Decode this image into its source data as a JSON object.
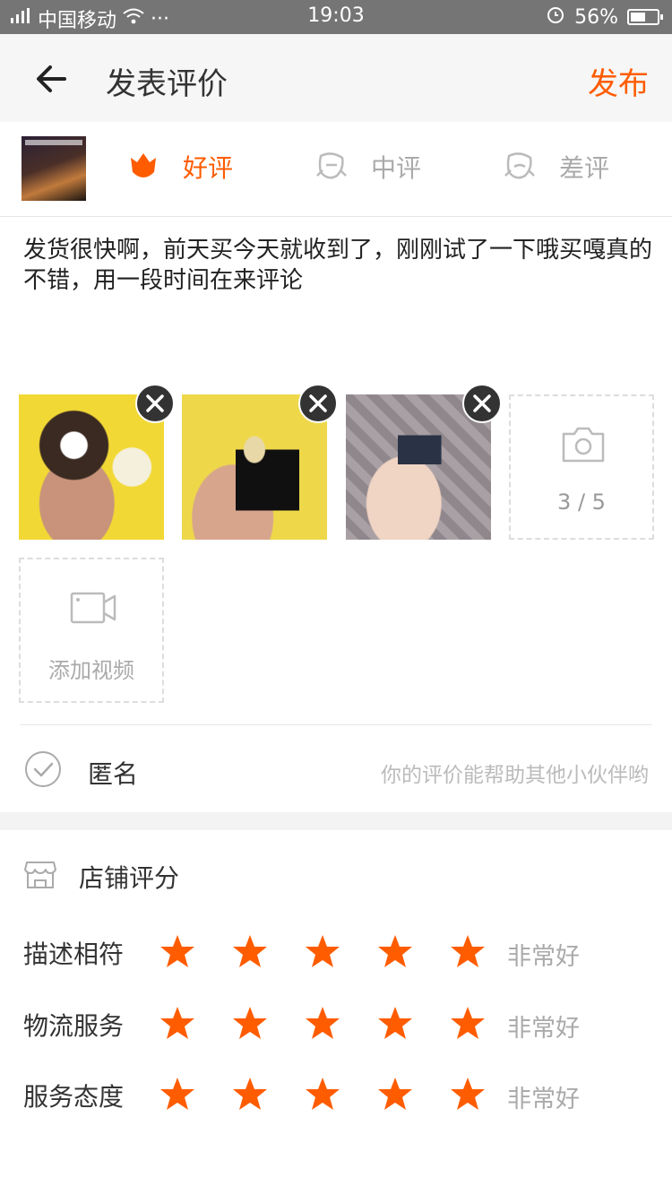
{
  "status_bar": {
    "carrier": "中国移动",
    "dots": "···",
    "time": "19:03",
    "battery_pct": "56%",
    "battery_level": 0.56
  },
  "header": {
    "title": "发表评价",
    "publish_label": "发布"
  },
  "rating_options": [
    {
      "label": "好评",
      "selected": true
    },
    {
      "label": "中评",
      "selected": false
    },
    {
      "label": "差评",
      "selected": false
    }
  ],
  "review": {
    "text": "发货很快啊，前天买今天就收到了，刚刚试了一下哦买嘎真的不错，用一段时间在来评论"
  },
  "photos": {
    "count_label": "3 / 5"
  },
  "video": {
    "add_label": "添加视频"
  },
  "anonymous": {
    "label": "匿名",
    "hint": "你的评价能帮助其他小伙伴哟"
  },
  "shop_rating": {
    "title": "店铺评分",
    "items": [
      {
        "label": "描述相符",
        "stars": 5,
        "text": "非常好"
      },
      {
        "label": "物流服务",
        "stars": 5,
        "text": "非常好"
      },
      {
        "label": "服务态度",
        "stars": 5,
        "text": "非常好"
      }
    ]
  },
  "colors": {
    "accent": "#ff5c00",
    "muted": "#aaaaaa"
  }
}
